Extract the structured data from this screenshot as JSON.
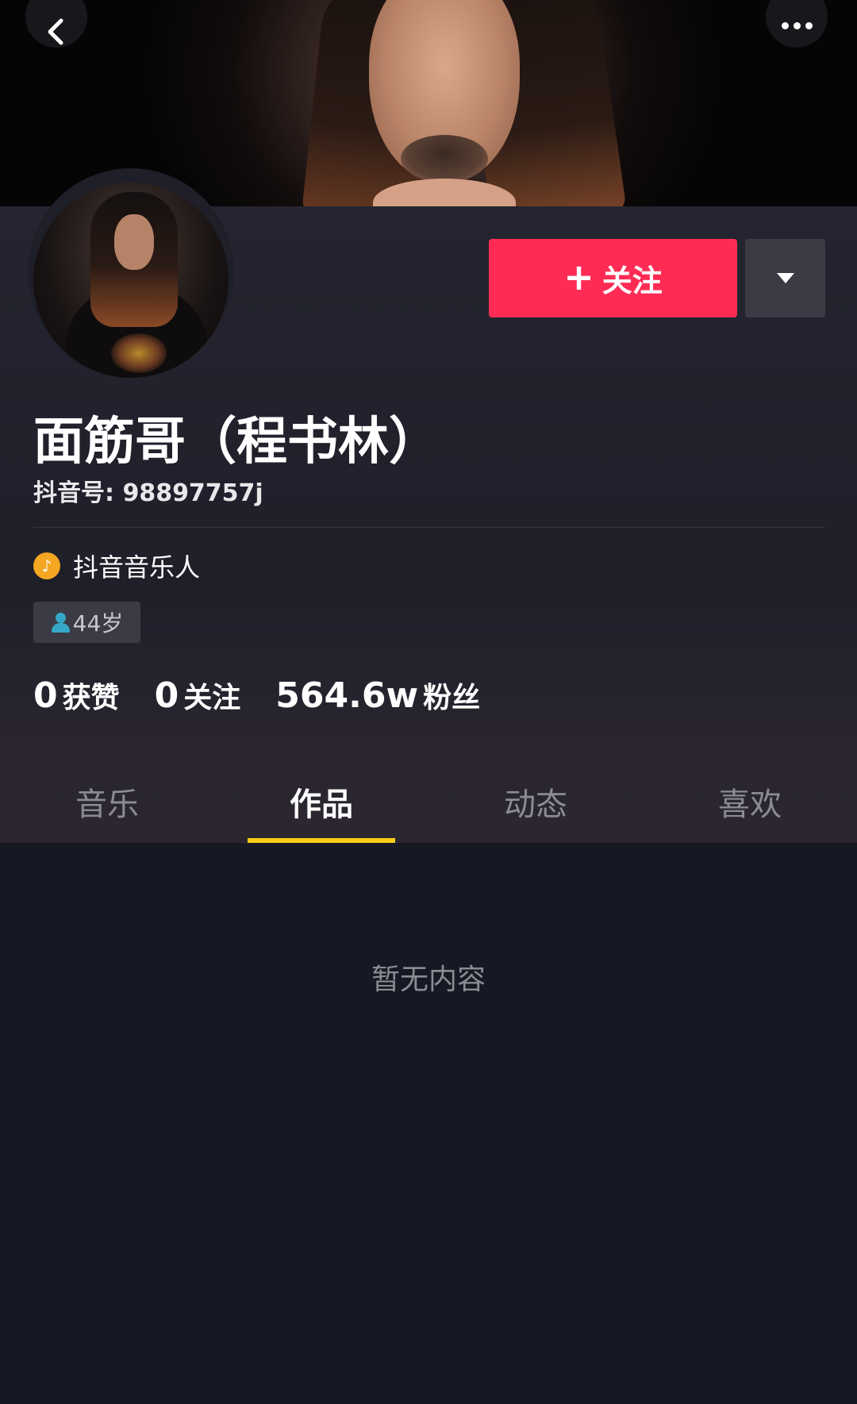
{
  "header": {
    "back_icon": "chevron-left-icon",
    "more_icon": "more-dots-icon"
  },
  "profile": {
    "name": "面筋哥（程书林）",
    "douyin_id": "抖音号: 98897757j",
    "follow_plus": "+",
    "follow_label": "关注",
    "badge_label": "抖音音乐人",
    "badge_icon": "music-note-icon",
    "age_label": "44岁",
    "accent_color": "#fe2c55"
  },
  "stats": [
    {
      "value": "0",
      "label": "获赞"
    },
    {
      "value": "0",
      "label": "关注"
    },
    {
      "value": "564.6w",
      "label": "粉丝"
    }
  ],
  "tabs": [
    {
      "label": "音乐",
      "active": false
    },
    {
      "label": "作品",
      "active": true
    },
    {
      "label": "动态",
      "active": false
    },
    {
      "label": "喜欢",
      "active": false
    }
  ],
  "content": {
    "empty_text": "暂无内容"
  }
}
